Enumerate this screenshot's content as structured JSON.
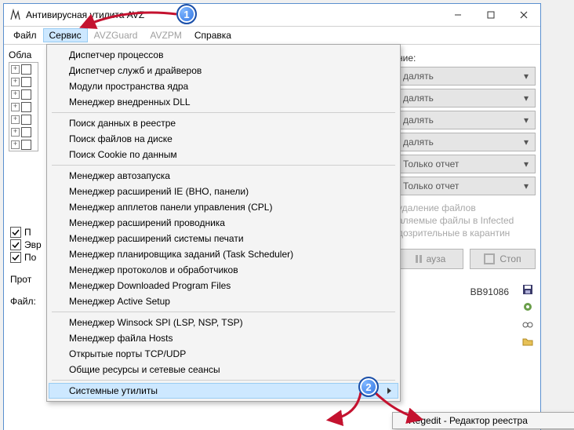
{
  "window": {
    "title": "Антивирусная утилита AVZ"
  },
  "menubar": {
    "file": "Файл",
    "service": "Сервис",
    "avzguard": "AVZGuard",
    "avzpm": "AVZPM",
    "help": "Справка"
  },
  "dropdown": {
    "items": [
      "Диспетчер процессов",
      "Диспетчер служб и драйверов",
      "Модули пространства ядра",
      "Менеджер внедренных DLL",
      "-",
      "Поиск данных  в реестре",
      "Поиск файлов на диске",
      "Поиск Cookie по данным",
      "-",
      "Менеджер автозапуска",
      "Менеджер расширений IE (BHO, панели)",
      "Менеджер апплетов панели управления (CPL)",
      "Менеджер расширений проводника",
      "Менеджер расширений системы печати",
      "Менеджер планировщика заданий (Task Scheduler)",
      "Менеджер протоколов и обработчиков",
      "Менеджер Downloaded Program Files",
      "Менеджер Active Setup",
      "-",
      "Менеджер Winsock SPI (LSP, NSP, TSP)",
      "Менеджер файла Hosts",
      "Открытые порты TCP/UDP",
      "Общие ресурсы и сетевые сеансы",
      "-",
      "Системные утилиты"
    ],
    "highlighted_index": 24
  },
  "submenu": {
    "item": "Regedit - Редактор реестра"
  },
  "bg": {
    "area_label": "Обла",
    "check_labels": [
      "П",
      "Эвр",
      "По"
    ],
    "prot_label": "Прот",
    "file_label": "Файл:"
  },
  "right": {
    "heal_label_tail": "ние:",
    "combo1": "далять",
    "combo2": "далять",
    "combo3": "далять",
    "combo4": "далять",
    "combo5": "Только отчет",
    "combo6": "Только отчет",
    "note1": "удаление файлов",
    "note2": "аляемые файлы в  Infected",
    "note3": "дозрительные в  карантин",
    "btn_pause": "ауза",
    "btn_stop": "Стоп",
    "log_tail": "BB91086"
  },
  "annotations": {
    "badge1": "1",
    "badge2": "2"
  }
}
